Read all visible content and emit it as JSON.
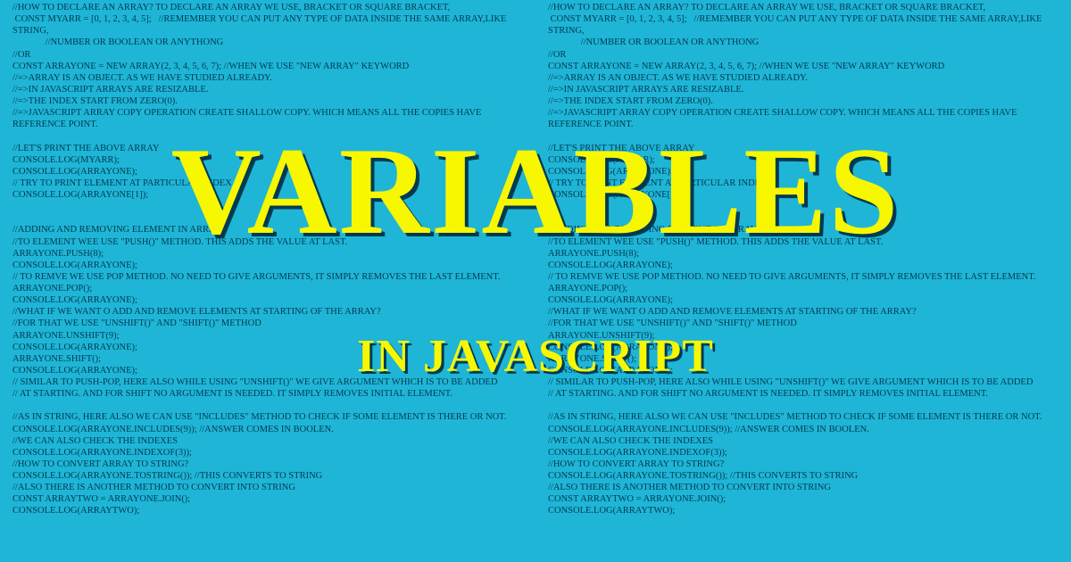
{
  "title": {
    "main": "VARIABLES",
    "sub": "IN JAVASCRIPT"
  },
  "code_block": "//HOW TO DECLARE AN ARRAY? TO DECLARE AN ARRAY WE USE, BRACKET OR SQUARE BRACKET,\n CONST MYARR = [0, 1, 2, 3, 4, 5];   //REMEMBER YOU CAN PUT ANY TYPE OF DATA INSIDE THE SAME ARRAY,LIKE STRING,\n              //NUMBER OR BOOLEAN OR ANYTHONG\n//OR\nCONST ARRAYONE = NEW ARRAY(2, 3, 4, 5, 6, 7); //WHEN WE USE \"NEW ARRAY\" KEYWORD\n//=>ARRAY IS AN OBJECT. AS WE HAVE STUDIED ALREADY.\n//=>IN JAVASCRIPT ARRAYS ARE RESIZABLE.\n//=>THE INDEX START FROM ZERO(0).\n//=>JAVASCRIPT ARRAY COPY OPERATION CREATE SHALLOW COPY. WHICH MEANS ALL THE COPIES HAVE REFERENCE POINT.\n\n//LET'S PRINT THE ABOVE ARRAY\nCONSOLE.LOG(MYARR);\nCONSOLE.LOG(ARRAYONE);\n// TRY TO PRINT ELEMENT AT PARTICULAR INDEX\nCONSOLE.LOG(ARRAYONE[1]);\n\n\n//ADDING AND REMOVING ELEMENT IN ARRAY\n//TO ELEMENT WEE USE \"PUSH()\" METHOD. THIS ADDS THE VALUE AT LAST.\nARRAYONE.PUSH(8);\nCONSOLE.LOG(ARRAYONE);\n// TO REMVE WE USE POP METHOD. NO NEED TO GIVE ARGUMENTS, IT SIMPLY REMOVES THE LAST ELEMENT.\nARRAYONE.POP();\nCONSOLE.LOG(ARRAYONE);\n//WHAT IF WE WANT O ADD AND REMOVE ELEMENTS AT STARTING OF THE ARRAY?\n//FOR THAT WE USE \"UNSHIFT()\" AND \"SHIFT()\" METHOD\nARRAYONE.UNSHIFT(9);\nCONSOLE.LOG(ARRAYONE);\nARRAYONE.SHIFT();\nCONSOLE.LOG(ARRAYONE);\n// SIMILAR TO PUSH-POP, HERE ALSO WHILE USING \"UNSHIFT()\" WE GIVE ARGUMENT WHICH IS TO BE ADDED\n// AT STARTING. AND FOR SHIFT NO ARGUMENT IS NEEDED. IT SIMPLY REMOVES INITIAL ELEMENT.\n\n//AS IN STRING, HERE ALSO WE CAN USE \"INCLUDES\" METHOD TO CHECK IF SOME ELEMENT IS THERE OR NOT.\nCONSOLE.LOG(ARRAYONE.INCLUDES(9)); //ANSWER COMES IN BOOLEN.\n//WE CAN ALSO CHECK THE INDEXES\nCONSOLE.LOG(ARRAYONE.INDEXOF(3));\n//HOW TO CONVERT ARRAY TO STRING?\nCONSOLE.LOG(ARRAYONE.TOSTRING()); //THIS CONVERTS TO STRING\n//ALSO THERE IS ANOTHER METHOD TO CONVERT INTO STRING\nCONST ARRAYTWO = ARRAYONE.JOIN();\nCONSOLE.LOG(ARRAYTWO);"
}
